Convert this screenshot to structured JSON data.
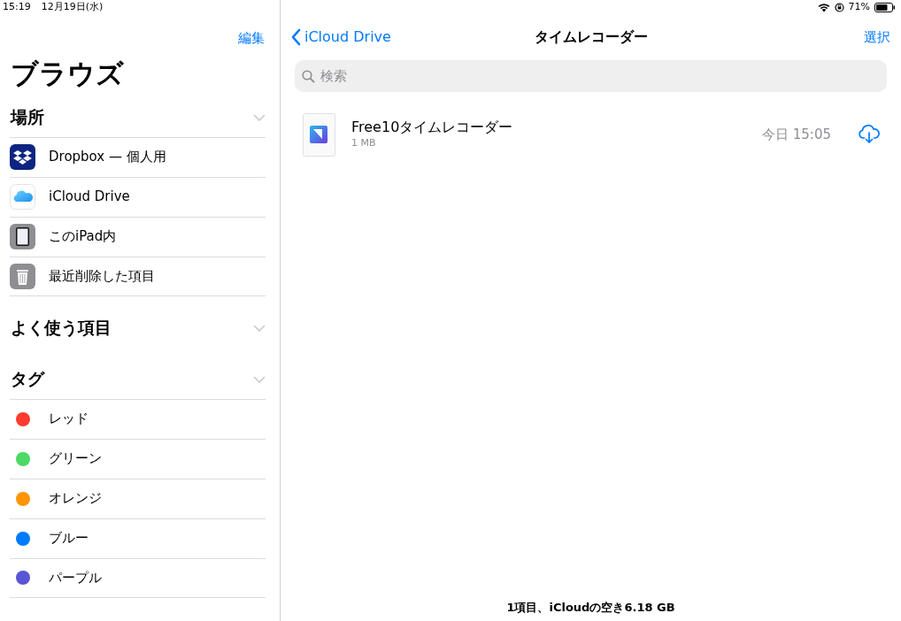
{
  "status_bar": {
    "time": "15:19",
    "date": "12月19日(水)",
    "battery_text": "71%"
  },
  "sidebar": {
    "edit_button": "編集",
    "title": "ブラウズ",
    "sections": [
      {
        "title": "場所",
        "items": [
          {
            "kind": "dropbox",
            "label": "Dropbox — 個人用"
          },
          {
            "kind": "icloud",
            "label": "iCloud Drive"
          },
          {
            "kind": "ipad",
            "label": "このiPad内"
          },
          {
            "kind": "trash",
            "label": "最近削除した項目"
          }
        ]
      },
      {
        "title": "よく使う項目"
      },
      {
        "title": "タグ",
        "items": [
          {
            "kind": "tag",
            "label": "レッド",
            "color": "#ff3b30"
          },
          {
            "kind": "tag",
            "label": "グリーン",
            "color": "#4cd964"
          },
          {
            "kind": "tag",
            "label": "オレンジ",
            "color": "#ff9500"
          },
          {
            "kind": "tag",
            "label": "ブルー",
            "color": "#007aff"
          },
          {
            "kind": "tag",
            "label": "パープル",
            "color": "#5856d6"
          }
        ]
      }
    ]
  },
  "main": {
    "back_button": "iCloud Drive",
    "title": "タイムレコーダー",
    "select_button": "選択",
    "search": {
      "placeholder": "検索"
    },
    "files": [
      {
        "name": "Free10タイムレコーダー",
        "size": "1 MB",
        "date": "今日 15:05"
      }
    ],
    "footer": "1項目、iCloudの空き6.18 GB"
  }
}
